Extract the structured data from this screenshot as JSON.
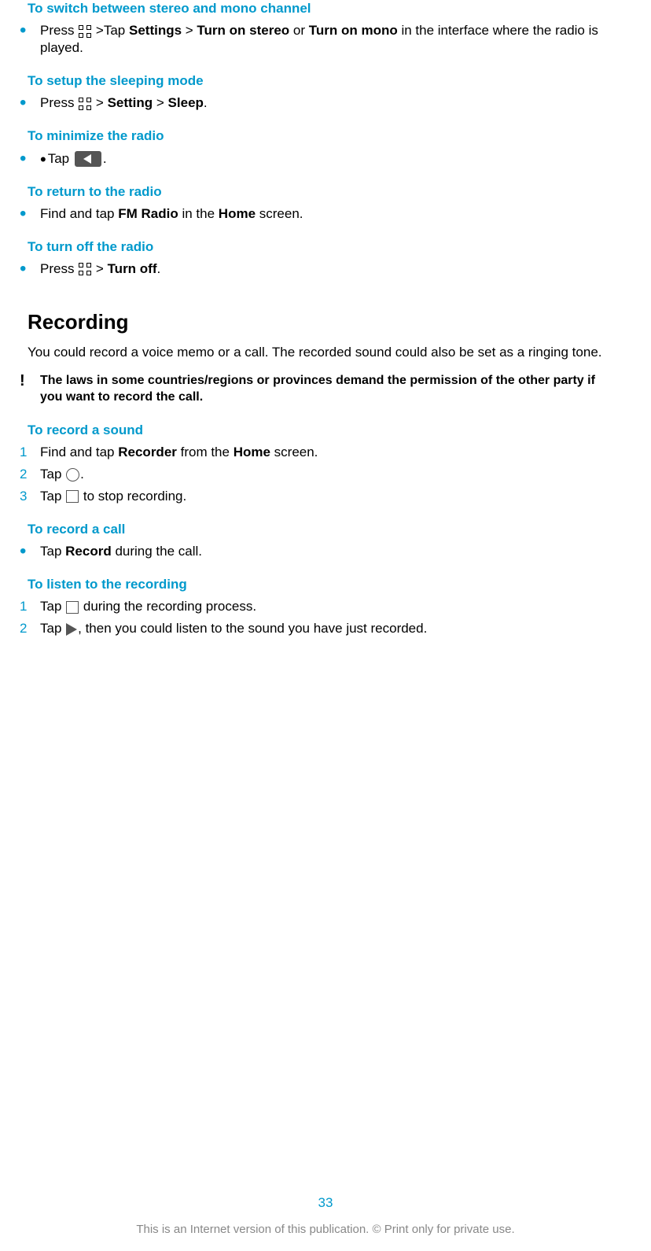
{
  "sections": {
    "switch_channel": {
      "title": "To switch between stereo and mono channel",
      "text_before_icon": "Press ",
      "text_after_icon_1": " >Tap ",
      "bold1": "Settings",
      "gt1": " > ",
      "bold2": "Turn on stereo",
      "or": " or ",
      "bold3": "Turn on mono",
      "text_end": " in the interface where the radio is played."
    },
    "sleeping_mode": {
      "title": "To setup the sleeping mode",
      "text_before": "Press ",
      "gt1": " > ",
      "bold1": "Setting",
      "gt2": " > ",
      "bold2": "Sleep",
      "dot": "."
    },
    "minimize": {
      "title": "To minimize the radio",
      "text_before": "Tap ",
      "dot": "."
    },
    "return_radio": {
      "title": "To return to the radio",
      "text1": "Find and tap ",
      "bold1": "FM Radio",
      "text2": " in the ",
      "bold2": "Home",
      "text3": " screen."
    },
    "turn_off": {
      "title": "To turn off the radio",
      "text_before": "Press ",
      "gt1": " > ",
      "bold1": "Turn off",
      "dot": "."
    },
    "recording": {
      "heading": "Recording",
      "intro": "You could record a voice memo or a call. The recorded sound could also be set as a ringing tone.",
      "warning": "The laws in some countries/regions or provinces demand the permission of the other party if you want to record the call."
    },
    "record_sound": {
      "title": "To record a sound",
      "step1_a": "Find and tap ",
      "step1_bold1": "Recorder",
      "step1_b": " from the ",
      "step1_bold2": "Home",
      "step1_c": " screen.",
      "step2_a": "Tap ",
      "step2_dot": ".",
      "step3_a": "Tap ",
      "step3_b": " to stop recording.",
      "n1": "1",
      "n2": "2",
      "n3": "3"
    },
    "record_call": {
      "title": "To record a call",
      "text1": "Tap ",
      "bold1": "Record",
      "text2": " during the call."
    },
    "listen": {
      "title": "To listen to the recording",
      "step1_a": "Tap ",
      "step1_b": " during the recording process.",
      "step2_a": "Tap ",
      "step2_b": ", then you could listen to the sound you have just recorded.",
      "n1": "1",
      "n2": "2"
    }
  },
  "footer": {
    "page": "33",
    "note": "This is an Internet version of this publication. © Print only for private use."
  }
}
